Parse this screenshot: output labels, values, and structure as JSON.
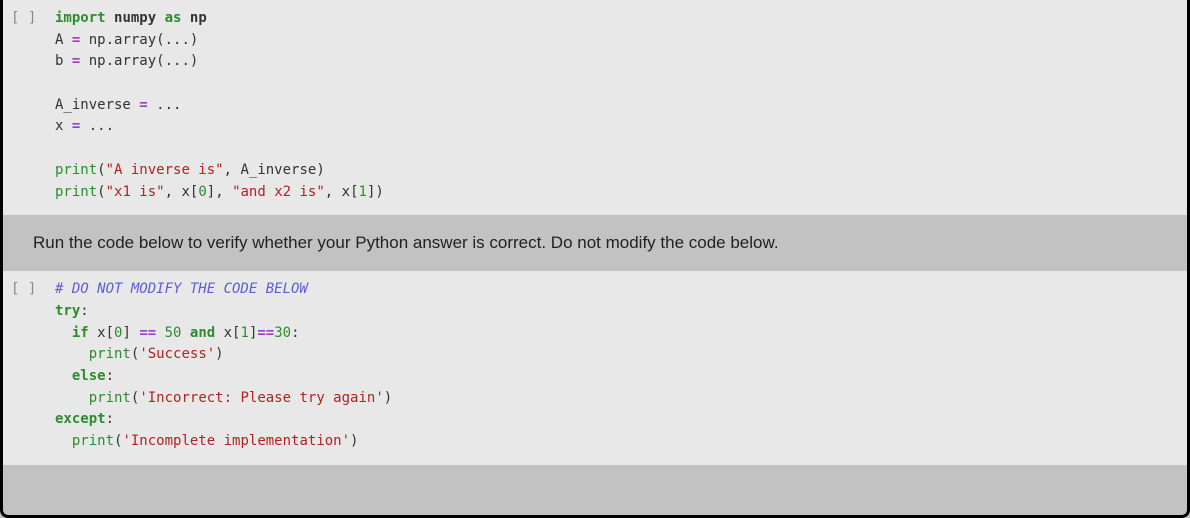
{
  "cell1": {
    "prompt": "[ ]",
    "code": {
      "l1_import": "import",
      "l1_numpy": "numpy",
      "l1_as": "as",
      "l1_np": "np",
      "l2_A": "A ",
      "l2_eq": "=",
      "l2_rest": " np.array(...)",
      "l3_b": "b ",
      "l3_eq": "=",
      "l3_rest": " np.array(...)",
      "l5_ainv": "A_inverse ",
      "l5_eq": "=",
      "l5_rest": " ...",
      "l6_x": "x ",
      "l6_eq": "=",
      "l6_rest": " ...",
      "l8_print": "print",
      "l8_p1": "(",
      "l8_str": "\"A inverse is\"",
      "l8_rest": ", A_inverse)",
      "l9_print": "print",
      "l9_p1": "(",
      "l9_str1": "\"x1 is\"",
      "l9_mid": ", x[",
      "l9_num0": "0",
      "l9_mid2": "], ",
      "l9_str2": "\"and x2 is\"",
      "l9_mid3": ", x[",
      "l9_num1": "1",
      "l9_end": "])"
    }
  },
  "textcell": {
    "text": "Run the code below to verify whether your Python answer is correct. Do not modify the code below."
  },
  "cell2": {
    "prompt": "[ ]",
    "code": {
      "l1_cmt": "# DO NOT MODIFY THE CODE BELOW",
      "l2_try": "try",
      "l2_colon": ":",
      "l3_if": "if",
      "l3_x0a": " x[",
      "l3_num0": "0",
      "l3_x0b": "] ",
      "l3_eqeq": "==",
      "l3_sp": " ",
      "l3_50": "50",
      "l3_sp2": " ",
      "l3_and": "and",
      "l3_x1a": " x[",
      "l3_num1": "1",
      "l3_x1b": "]",
      "l3_eqeq2": "==",
      "l3_30": "30",
      "l3_colon": ":",
      "l4_print": "print",
      "l4_p1": "(",
      "l4_str": "'Success'",
      "l4_p2": ")",
      "l5_else": "else",
      "l5_colon": ":",
      "l6_print": "print",
      "l6_p1": "(",
      "l6_str": "'Incorrect: Please try again'",
      "l6_p2": ")",
      "l7_except": "except",
      "l7_colon": ":",
      "l8_print": "print",
      "l8_p1": "(",
      "l8_str": "'Incomplete implementation'",
      "l8_p2": ")"
    }
  }
}
